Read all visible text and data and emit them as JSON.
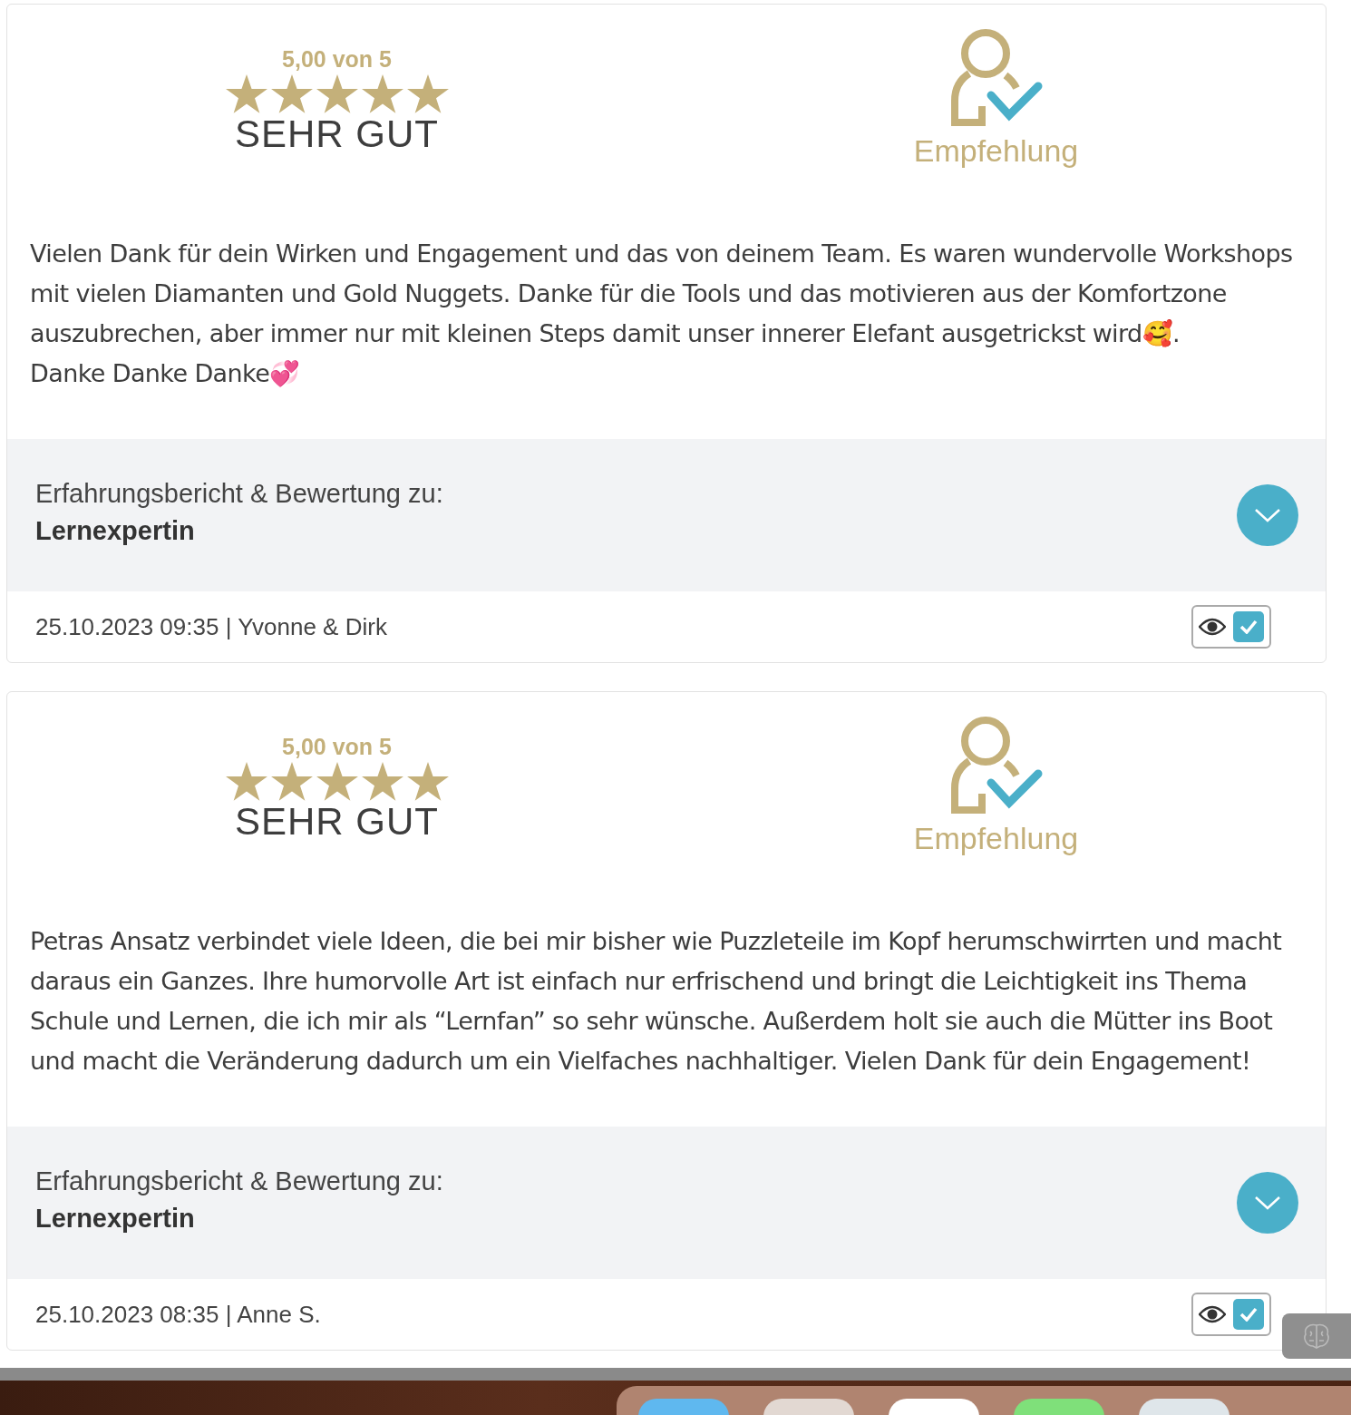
{
  "reviews": [
    {
      "score": "5,00 von 5",
      "stars": 5,
      "verdict": "SEHR GUT",
      "recommendation": "Empfehlung",
      "paragraphs": [
        "Vielen Dank für dein Wirken und Engagement und das von deinem Team. Es waren wundervolle Workshops mit vielen Diamanten und Gold Nuggets. Danke für die Tools und das motivieren aus der Komfortzone auszubrechen, aber immer nur mit kleinen Steps damit unser innerer Elefant ausgetrickst wird🥰.",
        "Danke Danke Danke💞"
      ],
      "about_label": "Erfahrungsbericht & Bewertung zu:",
      "about_name": "Lernexpertin",
      "expanded": false,
      "meta": "25.10.2023 09:35 | Yvonne & Dirk",
      "visible": true,
      "approved": true
    },
    {
      "score": "5,00 von 5",
      "stars": 5,
      "verdict": "SEHR GUT",
      "recommendation": "Empfehlung",
      "paragraphs": [
        "Petras Ansatz verbindet viele Ideen, die bei mir bisher wie Puzzleteile im Kopf herumschwirrten und macht daraus ein Ganzes. Ihre humorvolle Art ist einfach nur erfrischend und bringt die Leichtigkeit ins Thema Schule und Lernen, die ich mir als “Lernfan” so sehr wünsche. Außerdem holt sie auch die Mütter ins Boot und macht die Veränderung dadurch um ein Vielfaches nachhaltiger. Vielen Dank für dein Engagement!"
      ],
      "about_label": "Erfahrungsbericht & Bewertung zu:",
      "about_name": "Lernexpertin",
      "expanded": false,
      "meta": "25.10.2023 08:35 | Anne S.",
      "visible": true,
      "approved": true
    }
  ]
}
